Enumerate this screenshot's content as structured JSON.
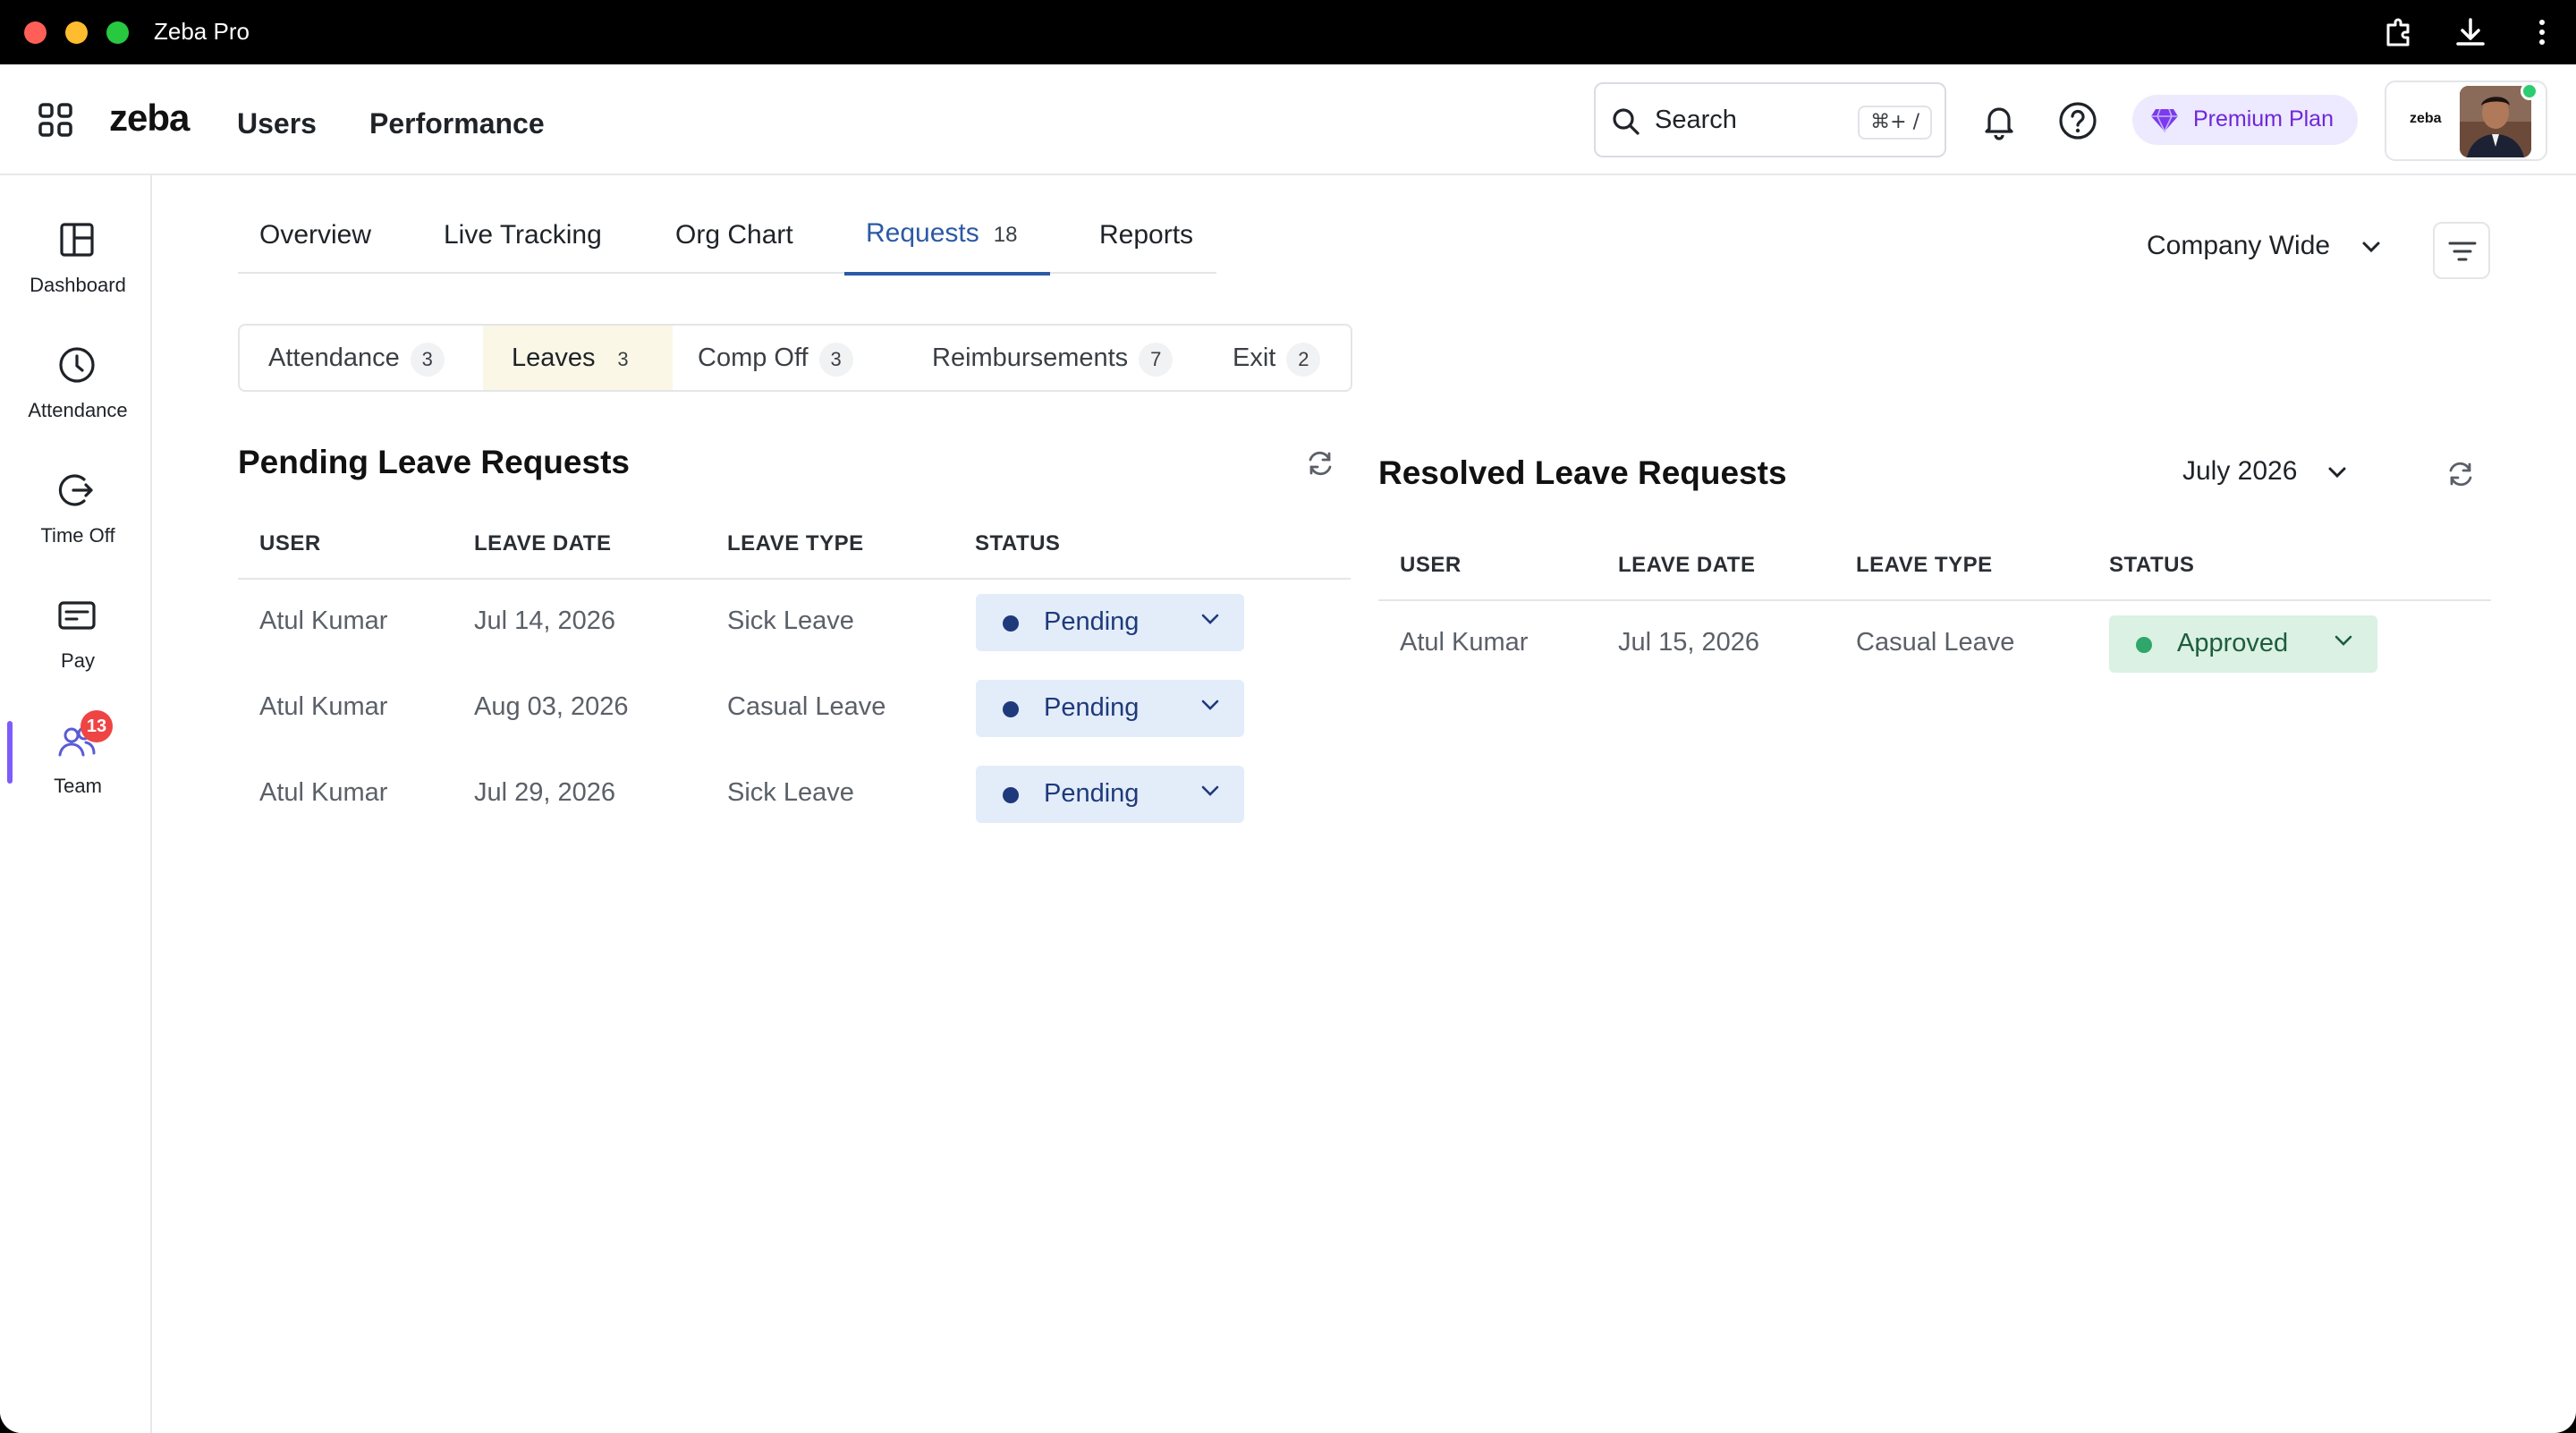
{
  "window": {
    "title": "Zeba Pro"
  },
  "header": {
    "logo": "zeba",
    "nav": [
      "Users",
      "Performance"
    ],
    "search": {
      "label": "Search",
      "shortcut": "⌘+ /"
    },
    "premium_label": "Premium Plan",
    "profile_logo": "zeba"
  },
  "sidebar": {
    "items": [
      {
        "label": "Dashboard",
        "icon": "layout-icon"
      },
      {
        "label": "Attendance",
        "icon": "clock-icon"
      },
      {
        "label": "Time Off",
        "icon": "logout-icon"
      },
      {
        "label": "Pay",
        "icon": "card-icon"
      },
      {
        "label": "Team",
        "icon": "users-icon",
        "badge": "13",
        "active": true
      }
    ]
  },
  "tabs": {
    "items": [
      {
        "label": "Overview"
      },
      {
        "label": "Live Tracking"
      },
      {
        "label": "Org Chart"
      },
      {
        "label": "Requests",
        "count": "18",
        "active": true
      },
      {
        "label": "Reports"
      }
    ],
    "scope_label": "Company Wide"
  },
  "subtabs": [
    {
      "label": "Attendance",
      "count": "3"
    },
    {
      "label": "Leaves",
      "count": "3",
      "active": true
    },
    {
      "label": "Comp Off",
      "count": "3"
    },
    {
      "label": "Reimbursements",
      "count": "7"
    },
    {
      "label": "Exit",
      "count": "2"
    }
  ],
  "pending": {
    "title": "Pending Leave Requests",
    "columns": [
      "USER",
      "LEAVE DATE",
      "LEAVE TYPE",
      "STATUS"
    ],
    "rows": [
      {
        "user": "Atul Kumar",
        "date": "Jul 14, 2026",
        "type": "Sick Leave",
        "status": "Pending"
      },
      {
        "user": "Atul Kumar",
        "date": "Aug 03, 2026",
        "type": "Casual Leave",
        "status": "Pending"
      },
      {
        "user": "Atul Kumar",
        "date": "Jul 29, 2026",
        "type": "Sick Leave",
        "status": "Pending"
      }
    ]
  },
  "resolved": {
    "title": "Resolved Leave Requests",
    "month": "July 2026",
    "columns": [
      "USER",
      "LEAVE DATE",
      "LEAVE TYPE",
      "STATUS"
    ],
    "rows": [
      {
        "user": "Atul Kumar",
        "date": "Jul 15, 2026",
        "type": "Casual Leave",
        "status": "Approved"
      }
    ]
  },
  "colors": {
    "accent": "#2b5aa6",
    "pending": "#1e3a7a",
    "approved": "#2fa66a",
    "premium": "#6d28d9"
  }
}
